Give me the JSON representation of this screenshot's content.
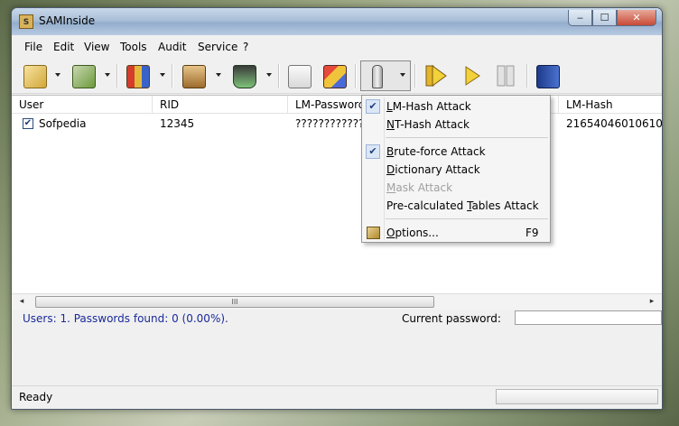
{
  "window": {
    "title": "SAMInside"
  },
  "caption_buttons": {
    "minimize": "‒",
    "maximize": "☐",
    "close": "✕"
  },
  "menubar": [
    {
      "label": "File"
    },
    {
      "label": "Edit"
    },
    {
      "label": "View"
    },
    {
      "label": "Tools"
    },
    {
      "label": "Audit"
    },
    {
      "label": "Service"
    },
    {
      "label": "?"
    }
  ],
  "toolbar": {
    "icons": [
      "open-folder-icon",
      "import-icon",
      "users-icon",
      "database-icon",
      "recycle-bin-icon",
      "checklist-icon",
      "cubes-icon",
      "key-attack-icon",
      "start-attack-icon",
      "play-icon",
      "pause-icon",
      "help-book-icon"
    ]
  },
  "table": {
    "columns": [
      "User",
      "RID",
      "LM-Password",
      "LM-Hash"
    ],
    "rows": [
      {
        "user": "Sofpedia",
        "rid": "12345",
        "lm_password": "?????????????",
        "lm_hash": "21654046010610"
      }
    ],
    "row_checked": true
  },
  "scrollbar": {
    "thumb_grip": "III",
    "left_arrow": "◂",
    "right_arrow": "▸"
  },
  "status": {
    "users_text": "Users: 1. Passwords found: 0 (0.00%).",
    "current_password_label": "Current password:",
    "current_password_value": "",
    "ready": "Ready"
  },
  "dropdown_menu": {
    "items": [
      {
        "label_prefix": "",
        "mnemonic": "L",
        "label_rest": "M-Hash Attack",
        "checked": true,
        "disabled": false
      },
      {
        "label_prefix": "",
        "mnemonic": "N",
        "label_rest": "T-Hash Attack",
        "checked": false,
        "disabled": false
      },
      {
        "label_prefix": "",
        "mnemonic": "B",
        "label_rest": "rute-force Attack",
        "checked": true,
        "disabled": false
      },
      {
        "label_prefix": "",
        "mnemonic": "D",
        "label_rest": "ictionary Attack",
        "checked": false,
        "disabled": false
      },
      {
        "label_prefix": "",
        "mnemonic": "M",
        "label_rest": "ask Attack",
        "checked": false,
        "disabled": true
      },
      {
        "label_prefix": "Pre-calculated ",
        "mnemonic": "T",
        "label_rest": "ables Attack",
        "checked": false,
        "disabled": false
      },
      {
        "label_prefix": "",
        "mnemonic": "O",
        "label_rest": "ptions...",
        "checked": false,
        "disabled": false,
        "shortcut": "F9"
      }
    ],
    "check_glyph": "✔"
  }
}
